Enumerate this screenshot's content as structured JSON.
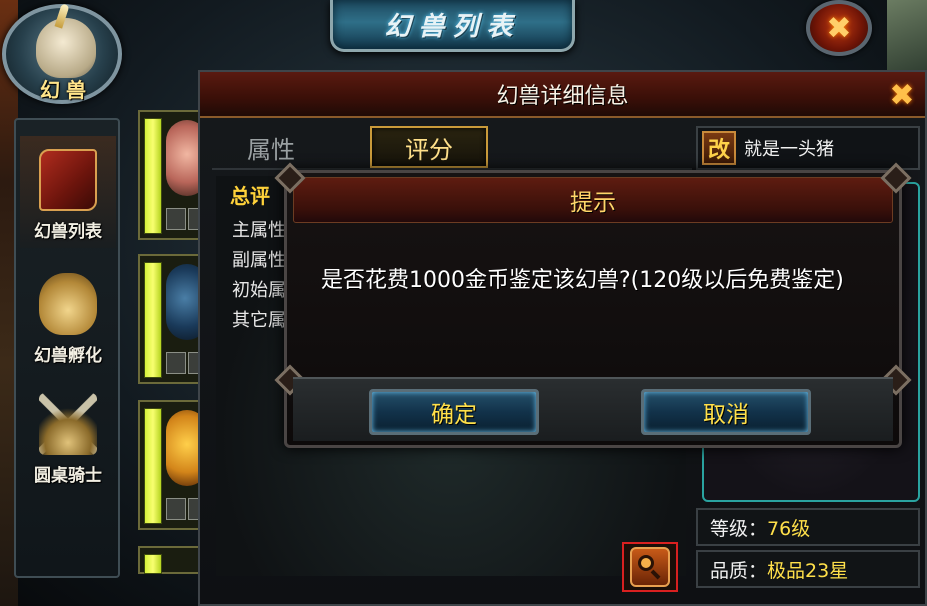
{
  "window": {
    "title": "幻兽列表",
    "emblem_label": "幻兽"
  },
  "sidebar": {
    "items": [
      {
        "label": "幻兽列表",
        "icon": "scroll-icon",
        "active": true
      },
      {
        "label": "幻兽孵化",
        "icon": "egg-icon",
        "active": false
      },
      {
        "label": "圆桌骑士",
        "icon": "crossed-swords-icon",
        "active": false
      }
    ]
  },
  "detail": {
    "title": "幻兽详细信息",
    "tabs": [
      {
        "label": "属性",
        "active": false
      },
      {
        "label": "评分",
        "active": true
      }
    ],
    "score": {
      "heading": "总评",
      "rows": [
        "主属性",
        "副属性",
        "初始属",
        "其它属"
      ]
    },
    "rename_label": "改",
    "pet_name": "就是一头猪",
    "stats": [
      {
        "label": "等级",
        "value": "76级"
      },
      {
        "label": "品质",
        "value": "极品23星"
      }
    ],
    "appraise_icon": "magnifier-icon"
  },
  "prompt": {
    "title": "提示",
    "message": "是否花费1000金币鉴定该幻兽?(120级以后免费鉴定)",
    "confirm_label": "确定",
    "cancel_label": "取消"
  },
  "colors": {
    "accent_gold": "#ffe04a",
    "header_red": "#5a1a10",
    "button_blue": "#24506a"
  }
}
